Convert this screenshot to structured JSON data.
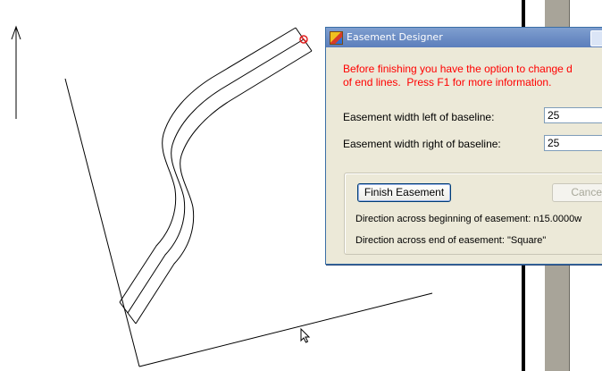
{
  "dialog": {
    "title": "Easement Designer",
    "warning": "Before finishing you have the option to change d\nof end lines.  Press F1 for more information.",
    "left_width": {
      "label": "Easement width left of baseline:",
      "value": "25"
    },
    "right_width": {
      "label": "Easement width right of baseline:",
      "value": "25"
    },
    "finish_label": "Finish Easement",
    "cancel_label": "Cancel",
    "direction_begin": "Direction across beginning of easement: n15.0000w",
    "direction_end": "Direction across end of easement: \"Square\""
  },
  "colors": {
    "warning": "#ff0000",
    "marker": "#e02020",
    "dialog_bg": "#ece9d8",
    "panel_gray": "#a8a499"
  },
  "icons": [
    "north-arrow-icon",
    "endpoint-marker-icon",
    "cursor-arrow-icon",
    "app-icon"
  ]
}
